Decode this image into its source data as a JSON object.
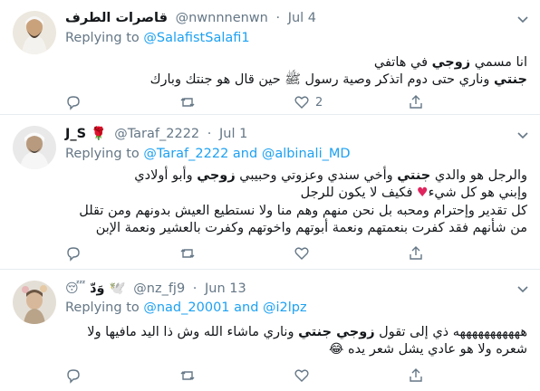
{
  "tweets": [
    {
      "name": "قاصرات الطرف",
      "handle": "@nwnnnenwn",
      "sep": "·",
      "date": "Jul 4",
      "replying_prefix": "Replying to",
      "replying_to_1": "@SalafistSalafi1",
      "replying_and": "",
      "replying_to_2": "",
      "body_lines": [
        "انا مسمي زوجي في هاتفي",
        "جنتي وناري حتى دوم اتذكر وصية رسول ﷺ حين قال هو جنتك وبارك"
      ],
      "counts": {
        "reply": "",
        "retweet": "",
        "like": "2"
      },
      "avatar_colors": [
        "#c9a27c",
        "#f2efe9"
      ]
    },
    {
      "name": "J_S",
      "name_emoji": "🌹",
      "handle": "@Taraf_2222",
      "sep": "·",
      "date": "Jul 1",
      "replying_prefix": "Replying to",
      "replying_to_1": "@Taraf_2222",
      "replying_and": "and",
      "replying_to_2": "@albinali_MD",
      "body_lines": [
        "والرجل هو والدي جنتي وأخي سندي وعزوتي وحبيبي زوجي وأبو أولادي",
        "وإبني هو كل شيء ♥ فكيف لا يكون للرجل",
        "كل تقدير وإحترام ومحبه بل نحن منهم وهم منا ولا نستطيع العيش بدونهم ومن تقلل",
        "من شأنهم فقد كفرت بنعمتهم ونعمة أبوتهم واخوتهم وكفرت بالعشير ونعمة الإبن"
      ],
      "counts": {
        "reply": "",
        "retweet": "",
        "like": ""
      },
      "avatar_colors": [
        "#b8b2a6",
        "#eeeeee"
      ]
    },
    {
      "name": "وَدّ 🕊️",
      "name_emoji": "😴",
      "handle": "@nz_fj9",
      "sep": "·",
      "date": "Jun 13",
      "replying_prefix": "Replying to",
      "replying_to_1": "@nad_20001",
      "replying_and": "and",
      "replying_to_2": "@i2lpz",
      "body_lines": [
        "هههههههههههه ذي إلى تقول زوجي جنتي وناري ماشاء الله وش ذا اليد مافيها ولا",
        "شعره ولا هو عادي يشل شعر يده 😂"
      ],
      "counts": {
        "reply": "",
        "retweet": "",
        "like": ""
      },
      "avatar_colors": [
        "#d9c3a8",
        "#e6e2db"
      ]
    }
  ],
  "colors": {
    "link": "#1da1f2",
    "muted": "#657786",
    "text": "#14171a",
    "heart": "#e0245e"
  },
  "icons": [
    "avatar",
    "chevron-down-icon",
    "reply-icon",
    "retweet-icon",
    "like-icon",
    "share-icon"
  ]
}
